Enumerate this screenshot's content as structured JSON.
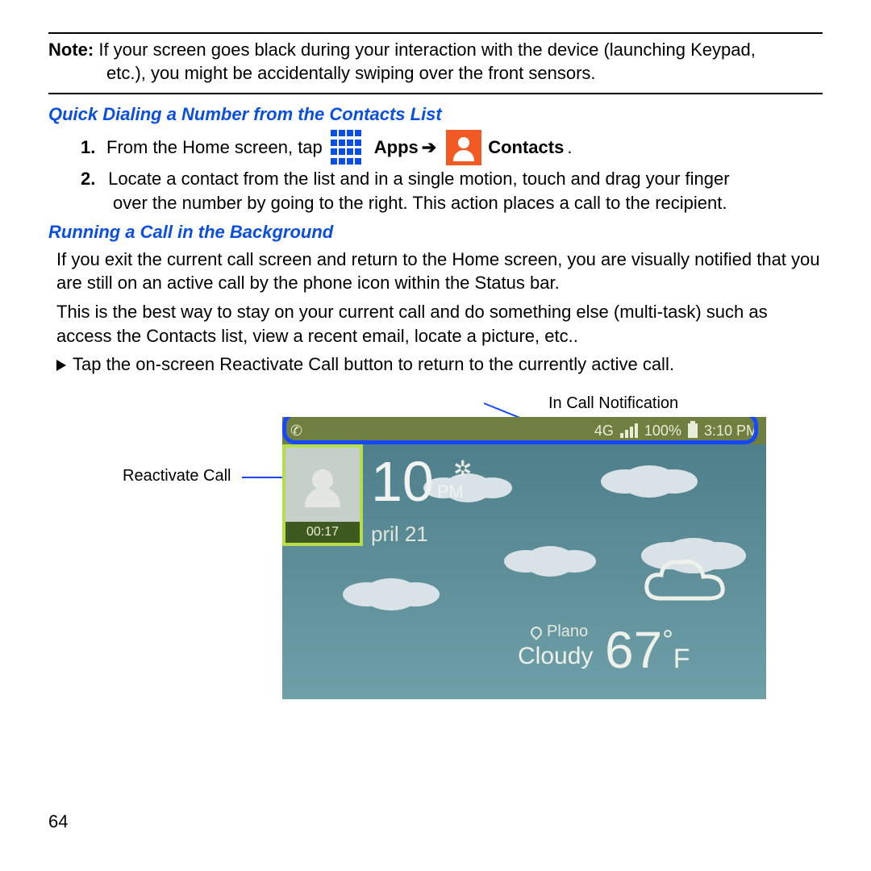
{
  "note": {
    "label": "Note:",
    "line1": "If your screen goes black during your interaction with the device (launching Keypad,",
    "line2": "etc.), you might be accidentally swiping over the front sensors."
  },
  "section1": {
    "heading": "Quick Dialing a Number from the Contacts List",
    "step1_num": "1.",
    "step1_a": "From the Home screen, tap",
    "apps_label": "Apps",
    "arrow": "➔",
    "contacts_label": "Contacts",
    "period": ".",
    "step2_num": "2.",
    "step2_a": "Locate a contact from the list and in a single motion, touch and drag your finger",
    "step2_b": "over the number by going to the right. This action places a call to the recipient."
  },
  "section2": {
    "heading": "Running a Call in the Background",
    "p1": "If you exit the current call screen and return to the Home screen, you are visually notified that you are still on an active call by the phone icon within the Status bar.",
    "p2": "This is the best way to stay on your current call and do something else (multi-task) such as access the Contacts list, view a recent email, locate a picture, etc..",
    "p3": "Tap the on-screen Reactivate Call button to return to the currently active call."
  },
  "figure": {
    "callout_top": "In Call Notification",
    "callout_left": "Reactivate Call",
    "status": {
      "network": "4G",
      "battery_pct": "100%",
      "time": "3:10 PM"
    },
    "timer": "00:17",
    "big_time_h": "10",
    "big_time_ampm": "PM",
    "date": "pril 21",
    "geo": "Plano",
    "cloudy": "Cloudy",
    "temp": "67",
    "deg": "°",
    "unit": "F"
  },
  "page_number": "64"
}
